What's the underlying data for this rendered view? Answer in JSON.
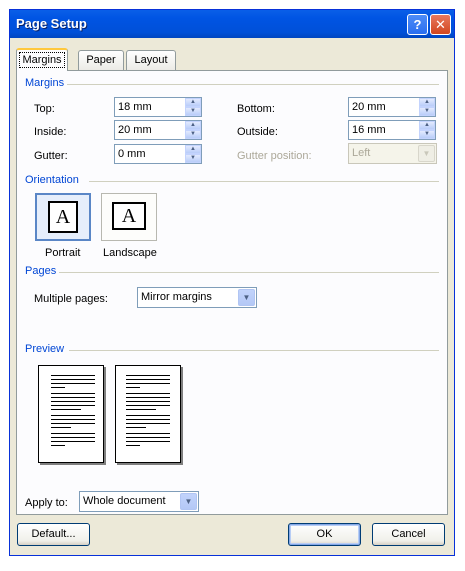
{
  "window": {
    "title": "Page Setup",
    "help_glyph": "?",
    "close_glyph": "✕"
  },
  "tabs": [
    {
      "label": "Margins",
      "active": true
    },
    {
      "label": "Paper",
      "active": false
    },
    {
      "label": "Layout",
      "active": false
    }
  ],
  "margins": {
    "section_title": "Margins",
    "top": {
      "label": "Top:",
      "value": "18 mm"
    },
    "bottom": {
      "label": "Bottom:",
      "value": "20 mm"
    },
    "inside": {
      "label": "Inside:",
      "value": "20 mm"
    },
    "outside": {
      "label": "Outside:",
      "value": "16 mm"
    },
    "gutter": {
      "label": "Gutter:",
      "value": "0 mm"
    },
    "gutter_position": {
      "label": "Gutter position:",
      "value": "Left",
      "enabled": false
    }
  },
  "orientation": {
    "section_title": "Orientation",
    "portrait_label": "Portrait",
    "landscape_label": "Landscape",
    "icon_letter": "A",
    "selected": "Portrait"
  },
  "pages": {
    "section_title": "Pages",
    "multiple_pages_label": "Multiple pages:",
    "multiple_pages_value": "Mirror margins"
  },
  "preview": {
    "section_title": "Preview"
  },
  "apply_to": {
    "label": "Apply to:",
    "value": "Whole document"
  },
  "buttons": {
    "default": "Default...",
    "ok": "OK",
    "cancel": "Cancel"
  },
  "glyphs": {
    "up": "▲",
    "down": "▼",
    "drop": "▼"
  }
}
